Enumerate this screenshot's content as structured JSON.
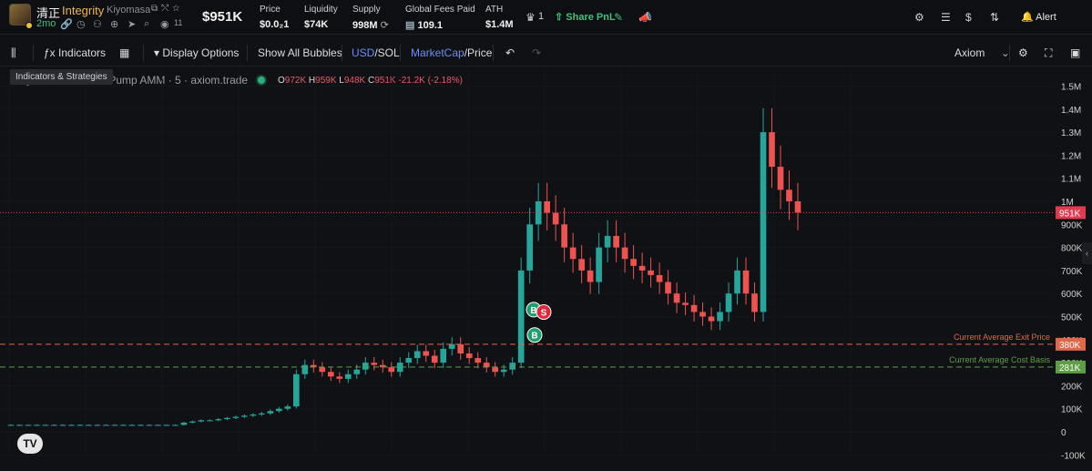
{
  "token": {
    "symbol": "清正",
    "name": "Integrity",
    "dev": "Kiyomasa",
    "age": "2mo",
    "holders_count": "11",
    "market_cap": "$951K"
  },
  "stats": [
    {
      "label": "Price",
      "value": "$0.0₂1"
    },
    {
      "label": "Liquidity",
      "value": "$74K"
    },
    {
      "label": "Supply",
      "value": "998M"
    },
    {
      "label": "Global Fees Paid",
      "value": "109.1"
    },
    {
      "label": "ATH",
      "value": "$1.4M"
    }
  ],
  "header_actions": {
    "watch_count": "1",
    "share_label": "Share PnL",
    "alert_label": "Alert"
  },
  "toolbar": {
    "indicators": "Indicators",
    "display_options": "Display Options",
    "show_bubbles": "Show All Bubbles",
    "usd": "USD",
    "sol": "/SOL",
    "mcap": "MarketCap",
    "price": "/Price",
    "source": "Axiom"
  },
  "tooltip": "Indicators & Strategies",
  "legend": {
    "title": "Kiyomasa/USD on Pump AMM · 5 · axiom.trade",
    "o_label": "O",
    "o": "972K",
    "h_label": "H",
    "h": "959K",
    "l_label": "L",
    "l": "948K",
    "c_label": "C",
    "c": "951K",
    "change": "-21.2K (-2.18%)"
  },
  "colors": {
    "up": "#26a69a",
    "down": "#ef5350",
    "exit_line": "#e0674a",
    "cost_line": "#5e9e45",
    "current_price": "#e03a4e"
  },
  "chart_data": {
    "type": "candlestick",
    "y_axis_ticks": [
      "1.5M",
      "1.4M",
      "1.3M",
      "1.2M",
      "1.1M",
      "1M",
      "900K",
      "800K",
      "700K",
      "600K",
      "500K",
      "400K",
      "300K",
      "200K",
      "100K",
      "0",
      "-100K"
    ],
    "ylim": [
      -100000,
      1550000
    ],
    "current_price": {
      "value": 951000,
      "label": "951K"
    },
    "lines": [
      {
        "name": "Current Average Exit Price",
        "value": 380000,
        "label": "380K"
      },
      {
        "name": "Current Average Cost Basis",
        "value": 281000,
        "label": "281K"
      }
    ],
    "trade_markers": [
      {
        "type": "B",
        "value": 530000
      },
      {
        "type": "S",
        "value": 520000
      },
      {
        "type": "B",
        "value": 420000
      }
    ],
    "approx_series_market_cap": [
      30000,
      30000,
      30000,
      30000,
      30000,
      30000,
      30000,
      30000,
      30000,
      30000,
      30000,
      30000,
      30000,
      30000,
      30000,
      30000,
      30000,
      30000,
      30000,
      30000,
      40000,
      45000,
      50000,
      50000,
      55000,
      60000,
      65000,
      70000,
      75000,
      80000,
      90000,
      100000,
      110000,
      250000,
      290000,
      280000,
      260000,
      240000,
      230000,
      250000,
      270000,
      300000,
      290000,
      280000,
      260000,
      300000,
      320000,
      350000,
      330000,
      300000,
      360000,
      380000,
      340000,
      320000,
      300000,
      280000,
      260000,
      270000,
      300000,
      700000,
      900000,
      1000000,
      950000,
      900000,
      800000,
      750000,
      700000,
      650000,
      800000,
      850000,
      800000,
      750000,
      720000,
      700000,
      680000,
      650000,
      600000,
      560000,
      550000,
      520000,
      500000,
      480000,
      520000,
      600000,
      700000,
      600000,
      520000,
      1300000,
      1150000,
      1050000,
      1000000,
      951000
    ]
  }
}
